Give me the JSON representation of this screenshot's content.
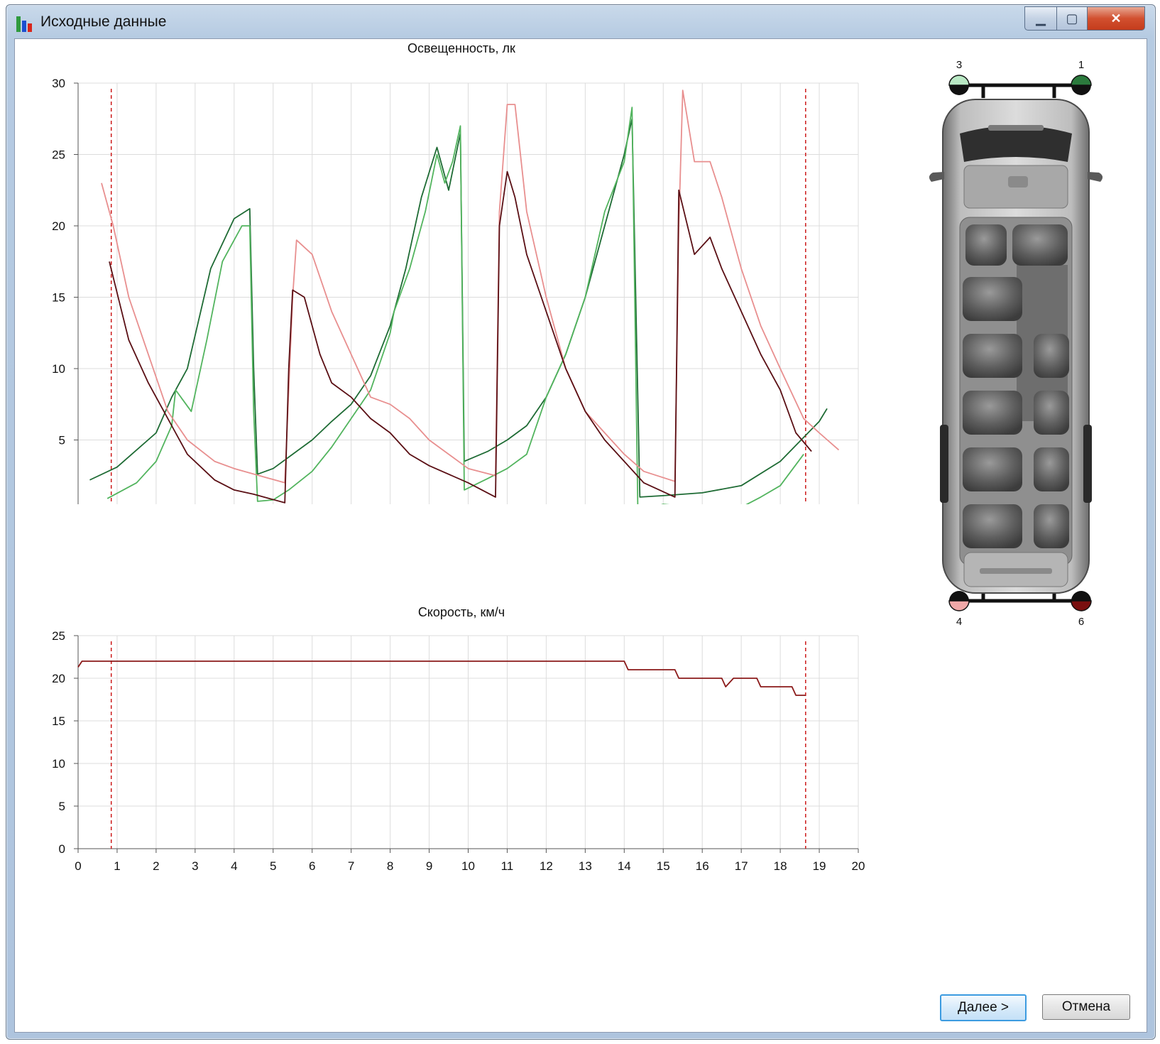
{
  "window": {
    "title": "Исходные данные",
    "controls": {
      "minimize": "▁",
      "maximize": "▢",
      "close": "✕"
    }
  },
  "buttons": {
    "next": "Далее >",
    "cancel": "Отмена"
  },
  "vehicle": {
    "top_left_label": "3",
    "top_right_label": "1",
    "bottom_left_label": "4",
    "bottom_right_label": "6"
  },
  "colors": {
    "sensor_1": "#1e6b34",
    "sensor_3": "#52b45e",
    "sensor_4": "#e88f8f",
    "sensor_6": "#5a0f14",
    "marker": "#cc1a1a",
    "speed": "#8b1a1a"
  },
  "chart_data": [
    {
      "type": "line",
      "title": "Освещенность, лк",
      "xlabel": "",
      "ylabel": "",
      "xlim": [
        0,
        20
      ],
      "ylim": [
        0,
        30
      ],
      "xticks": [
        "0",
        "1",
        "2",
        "3",
        "4",
        "5",
        "6",
        "7",
        "8",
        "9",
        "10",
        "11",
        "12",
        "13",
        "14",
        "15",
        "16",
        "17",
        "18",
        "19",
        "20"
      ],
      "yticks": [
        "0",
        "5",
        "10",
        "15",
        "20",
        "25",
        "30"
      ],
      "grid": true,
      "markers_x": [
        0.85,
        18.65
      ],
      "series": [
        {
          "color": "#1e6b34",
          "points": [
            [
              0.3,
              2.2
            ],
            [
              1,
              3.1
            ],
            [
              2,
              5.5
            ],
            [
              2.4,
              8
            ],
            [
              2.8,
              10
            ],
            [
              3.4,
              17
            ],
            [
              4,
              20.5
            ],
            [
              4.4,
              21.2
            ],
            [
              4.5,
              10
            ],
            [
              4.6,
              2.6
            ],
            [
              5,
              3
            ],
            [
              5.5,
              4
            ],
            [
              6,
              5
            ],
            [
              6.5,
              6.3
            ],
            [
              7,
              7.5
            ],
            [
              7.5,
              9.5
            ],
            [
              8,
              13
            ],
            [
              8.4,
              17
            ],
            [
              8.8,
              22
            ],
            [
              9.2,
              25.5
            ],
            [
              9.5,
              22.5
            ],
            [
              9.8,
              26.5
            ],
            [
              9.9,
              3.5
            ],
            [
              10.5,
              4.2
            ],
            [
              11,
              5
            ],
            [
              11.5,
              6
            ],
            [
              12,
              8
            ],
            [
              12.5,
              11
            ],
            [
              13,
              15
            ],
            [
              13.5,
              20
            ],
            [
              14,
              25
            ],
            [
              14.2,
              27.5
            ],
            [
              14.4,
              1
            ],
            [
              15,
              1.1
            ],
            [
              16,
              1.3
            ],
            [
              17,
              1.8
            ],
            [
              18,
              3.5
            ],
            [
              19,
              6.3
            ],
            [
              19.2,
              7.2
            ]
          ]
        },
        {
          "color": "#52b45e",
          "points": [
            [
              0.75,
              0.9
            ],
            [
              1.5,
              2
            ],
            [
              2,
              3.5
            ],
            [
              2.4,
              6
            ],
            [
              2.5,
              8.5
            ],
            [
              2.9,
              7
            ],
            [
              3.3,
              12
            ],
            [
              3.7,
              17.5
            ],
            [
              4,
              19
            ],
            [
              4.2,
              20
            ],
            [
              4.4,
              20
            ],
            [
              4.5,
              7
            ],
            [
              4.6,
              0.7
            ],
            [
              5,
              0.8
            ],
            [
              5.4,
              1.5
            ],
            [
              6,
              2.8
            ],
            [
              6.5,
              4.5
            ],
            [
              7,
              6.5
            ],
            [
              7.5,
              8.5
            ],
            [
              8,
              12.5
            ],
            [
              8.1,
              14
            ],
            [
              8.5,
              17
            ],
            [
              8.9,
              21
            ],
            [
              9.2,
              25
            ],
            [
              9.4,
              23
            ],
            [
              9.6,
              24.5
            ],
            [
              9.8,
              27
            ],
            [
              9.9,
              1.5
            ],
            [
              10.5,
              2.3
            ],
            [
              11,
              3
            ],
            [
              11.5,
              4
            ],
            [
              12,
              8
            ],
            [
              12.5,
              11
            ],
            [
              13,
              15
            ],
            [
              13.5,
              21
            ],
            [
              14,
              24.5
            ],
            [
              14.2,
              28.3
            ],
            [
              14.35,
              0
            ],
            [
              15,
              0.5
            ],
            [
              16.8,
              0
            ],
            [
              17.5,
              1
            ],
            [
              18,
              1.8
            ],
            [
              18.6,
              4
            ]
          ]
        },
        {
          "color": "#e88f8f",
          "points": [
            [
              0.6,
              23
            ],
            [
              0.9,
              20
            ],
            [
              1.3,
              15
            ],
            [
              1.8,
              11
            ],
            [
              2.3,
              7
            ],
            [
              2.8,
              5
            ],
            [
              3.5,
              3.5
            ],
            [
              4,
              3
            ],
            [
              5.3,
              2
            ],
            [
              5.5,
              15
            ],
            [
              5.6,
              19
            ],
            [
              6,
              18
            ],
            [
              6.5,
              14
            ],
            [
              7,
              11
            ],
            [
              7.5,
              8
            ],
            [
              8,
              7.5
            ],
            [
              8.5,
              6.5
            ],
            [
              9,
              5
            ],
            [
              10,
              3
            ],
            [
              10.7,
              2.5
            ],
            [
              10.8,
              21
            ],
            [
              11,
              28.5
            ],
            [
              11.2,
              28.5
            ],
            [
              11.5,
              21
            ],
            [
              12,
              15
            ],
            [
              12.5,
              10
            ],
            [
              13,
              7
            ],
            [
              13.5,
              5.5
            ],
            [
              14,
              4
            ],
            [
              14.5,
              2.8
            ],
            [
              15.3,
              2.1
            ],
            [
              15.4,
              20
            ],
            [
              15.5,
              29.5
            ],
            [
              15.8,
              24.5
            ],
            [
              16.2,
              24.5
            ],
            [
              16.5,
              22
            ],
            [
              17,
              17
            ],
            [
              17.5,
              13
            ],
            [
              18,
              10
            ],
            [
              18.6,
              6.5
            ],
            [
              19,
              5.5
            ],
            [
              19.5,
              4.3
            ]
          ]
        },
        {
          "color": "#5a0f14",
          "points": [
            [
              0.8,
              17.5
            ],
            [
              1.3,
              12
            ],
            [
              1.8,
              9
            ],
            [
              2.2,
              7
            ],
            [
              2.5,
              5.5
            ],
            [
              2.8,
              4
            ],
            [
              3.5,
              2.2
            ],
            [
              4,
              1.5
            ],
            [
              4.5,
              1.2
            ],
            [
              5.3,
              0.6
            ],
            [
              5.4,
              10
            ],
            [
              5.5,
              15.5
            ],
            [
              5.8,
              15
            ],
            [
              6.2,
              11
            ],
            [
              6.5,
              9
            ],
            [
              7,
              8
            ],
            [
              7.5,
              6.5
            ],
            [
              8,
              5.5
            ],
            [
              8.5,
              4
            ],
            [
              9,
              3.2
            ],
            [
              10,
              2
            ],
            [
              10.7,
              1
            ],
            [
              10.8,
              20
            ],
            [
              11,
              23.8
            ],
            [
              11.2,
              22
            ],
            [
              11.5,
              18
            ],
            [
              12,
              14
            ],
            [
              12.5,
              10
            ],
            [
              13,
              7
            ],
            [
              13.5,
              5
            ],
            [
              14,
              3.5
            ],
            [
              14.5,
              2
            ],
            [
              15.3,
              1
            ],
            [
              15.4,
              22.5
            ],
            [
              15.8,
              18
            ],
            [
              16.2,
              19.2
            ],
            [
              16.5,
              17
            ],
            [
              17,
              14
            ],
            [
              17.5,
              11
            ],
            [
              18,
              8.5
            ],
            [
              18.4,
              5.5
            ],
            [
              18.8,
              4.2
            ]
          ]
        }
      ]
    },
    {
      "type": "line",
      "title": "Скорость, км/ч",
      "xlabel": "",
      "ylabel": "",
      "xlim": [
        0,
        20
      ],
      "ylim": [
        0,
        25
      ],
      "xticks": [
        "0",
        "1",
        "2",
        "3",
        "4",
        "5",
        "6",
        "7",
        "8",
        "9",
        "10",
        "11",
        "12",
        "13",
        "14",
        "15",
        "16",
        "17",
        "18",
        "19",
        "20"
      ],
      "yticks": [
        "0",
        "5",
        "10",
        "15",
        "20",
        "25"
      ],
      "grid": true,
      "markers_x": [
        0.85,
        18.65
      ],
      "series": [
        {
          "color": "#8b1a1a",
          "points": [
            [
              0,
              21.3
            ],
            [
              0.1,
              22
            ],
            [
              14,
              22
            ],
            [
              14.1,
              21
            ],
            [
              15.3,
              21
            ],
            [
              15.4,
              20
            ],
            [
              16.5,
              20
            ],
            [
              16.6,
              19
            ],
            [
              16.8,
              20
            ],
            [
              17.4,
              20
            ],
            [
              17.5,
              19
            ],
            [
              18.3,
              19
            ],
            [
              18.4,
              18
            ],
            [
              18.65,
              18
            ]
          ]
        }
      ]
    }
  ]
}
